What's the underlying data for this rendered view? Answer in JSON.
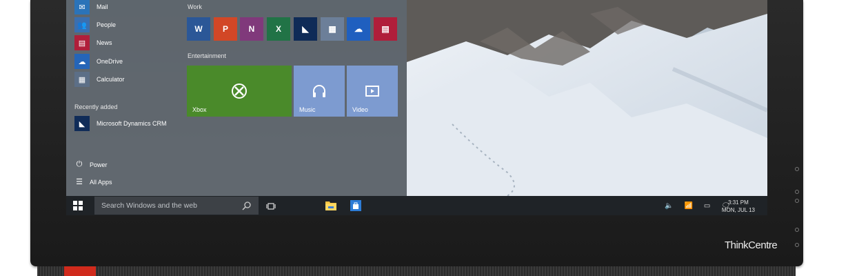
{
  "device": {
    "brand": "ThinkCentre"
  },
  "start_menu": {
    "apps": [
      {
        "label": "Mail",
        "icon": "mail-icon",
        "color": "#2b73b8"
      },
      {
        "label": "People",
        "icon": "people-icon",
        "color": "#3a6fb0"
      },
      {
        "label": "News",
        "icon": "news-icon",
        "color": "#b01e3a"
      },
      {
        "label": "OneDrive",
        "icon": "onedrive-icon",
        "color": "#2565b8"
      },
      {
        "label": "Calculator",
        "icon": "calculator-icon",
        "color": "#5c6f87"
      }
    ],
    "recently_added_label": "Recently added",
    "recent_app": {
      "label": "Microsoft Dynamics CRM",
      "icon": "dynamics-crm-icon",
      "color": "#102c58"
    },
    "power_label": "Power",
    "all_apps_label": "All Apps",
    "groups": {
      "work_label": "Work",
      "entertainment_label": "Entertainment"
    },
    "work_tiles": [
      {
        "name": "word",
        "glyph": "W",
        "color": "#2b5797"
      },
      {
        "name": "powerpoint",
        "glyph": "P",
        "color": "#d24726"
      },
      {
        "name": "onenote",
        "glyph": "N",
        "color": "#80397b"
      },
      {
        "name": "excel",
        "glyph": "X",
        "color": "#217346"
      },
      {
        "name": "dynamics-crm",
        "glyph": "◣",
        "color": "#0f2b57"
      },
      {
        "name": "calculator",
        "glyph": "▦",
        "color": "#6c7f99"
      },
      {
        "name": "onedrive",
        "glyph": "☁",
        "color": "#1f5fbf"
      },
      {
        "name": "news",
        "glyph": "▤",
        "color": "#b01e3a"
      }
    ],
    "entertainment_tiles": [
      {
        "name": "xbox",
        "label": "Xbox",
        "color": "#4a8a2a"
      },
      {
        "name": "music",
        "label": "Music",
        "color": "#7d9bd0"
      },
      {
        "name": "video",
        "label": "Video",
        "color": "#7d9bd0"
      }
    ]
  },
  "taskbar": {
    "search_placeholder": "Search Windows and the web",
    "time": "3:31 PM",
    "date": "MON, JUL 13"
  }
}
